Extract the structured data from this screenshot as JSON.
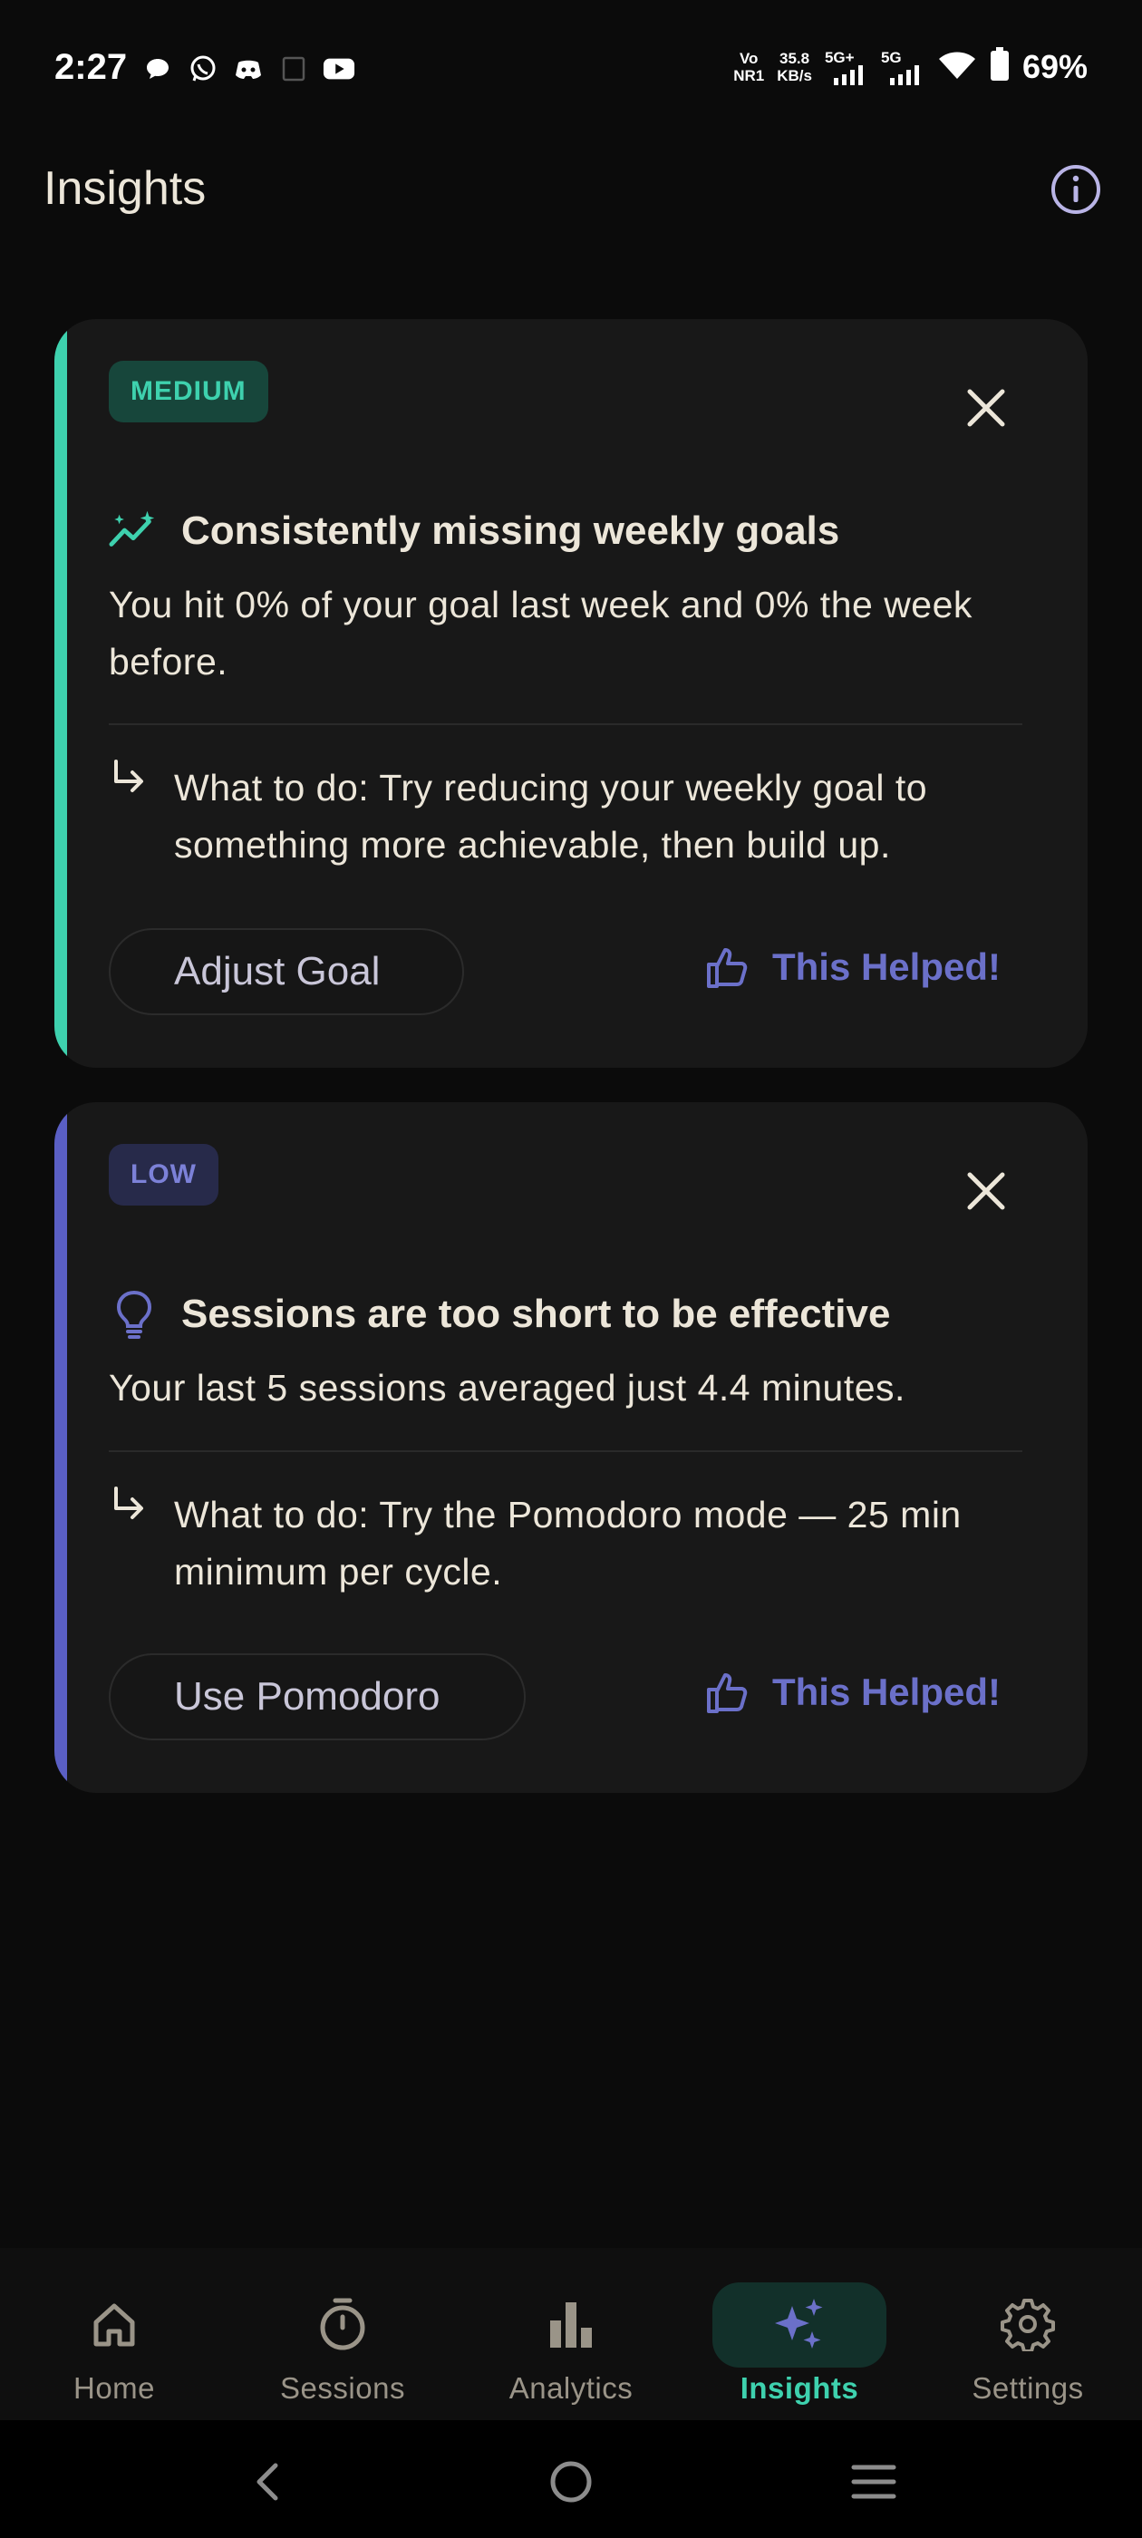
{
  "status_bar": {
    "time": "2:27",
    "network_top": "Vo",
    "network_bottom": "NR1",
    "speed_top": "35.8",
    "speed_bottom": "KB/s",
    "sig1": "5G+",
    "sig2": "5G",
    "battery": "69%"
  },
  "header": {
    "title": "Insights",
    "info_icon": "info-icon"
  },
  "colors": {
    "accent_medium": "#3ed1ae",
    "accent_low": "#5a5fc4",
    "helped": "#6b70c9",
    "background": "#0b0b0b",
    "card": "#181818"
  },
  "cards": [
    {
      "badge": "MEDIUM",
      "icon": "trend-sparkle-icon",
      "title": "Consistently missing weekly goals",
      "description": "You hit 0% of your goal last week and 0% the week before.",
      "todo": "What to do: Try reducing your weekly goal to something more achievable, then build up.",
      "action": "Adjust Goal",
      "helped": "This Helped!"
    },
    {
      "badge": "LOW",
      "icon": "lightbulb-icon",
      "title": "Sessions are too short to be effective",
      "description": "Your last 5 sessions averaged just 4.4 minutes.",
      "todo": "What to do: Try the Pomodoro mode — 25 min minimum per cycle.",
      "action": "Use Pomodoro",
      "helped": "This Helped!"
    }
  ],
  "nav": {
    "items": [
      {
        "label": "Home",
        "icon": "home-icon"
      },
      {
        "label": "Sessions",
        "icon": "timer-icon"
      },
      {
        "label": "Analytics",
        "icon": "bar-chart-icon"
      },
      {
        "label": "Insights",
        "icon": "sparkle-icon",
        "active": true
      },
      {
        "label": "Settings",
        "icon": "gear-icon"
      }
    ]
  }
}
